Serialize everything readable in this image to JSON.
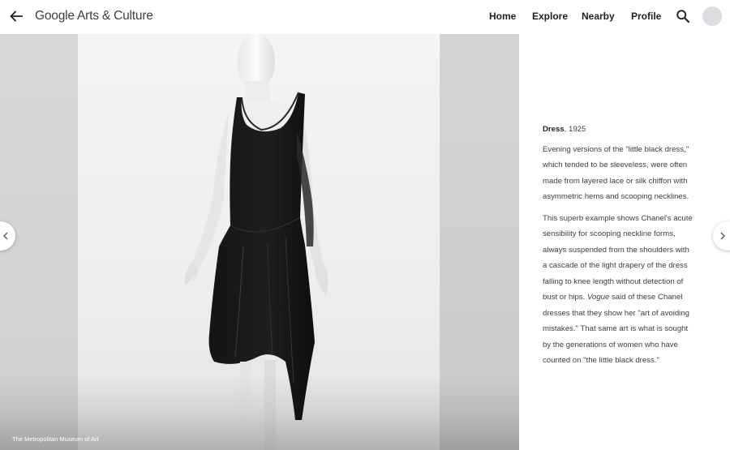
{
  "header": {
    "logo_text": "Google Arts & Culture",
    "nav": {
      "home": "Home",
      "explore": "Explore",
      "nearby": "Nearby",
      "profile": "Profile"
    },
    "icons": {
      "back": "arrow-back-icon",
      "search": "search-icon"
    }
  },
  "viewer": {
    "credit": "The Metropolitan Museum of Art",
    "prev_icon": "chevron-left-icon",
    "next_icon": "chevron-right-icon"
  },
  "artwork": {
    "title": "Dress",
    "date": ", 1925",
    "paragraph1": [
      "Evening versions of the \"little black dress,\"",
      "which tended to be sleeveless, were often",
      "made from layered lace or silk chiffon with",
      "asymmetric hems and scooping necklines."
    ],
    "paragraph2": [
      "This superb example shows Chanel's acute",
      "sensibility for scooping neckline forms,",
      "always suspended from the shoulders with",
      "a cascade of the light drapery of the dress",
      "falling to knee length without detection of"
    ],
    "p2_line6_before": "bust or hips. ",
    "p2_line6_italic": "Vogue",
    "p2_line6_after": " said of these Chanel",
    "paragraph2_end": [
      "dresses that they show her \"art of avoiding",
      "mistakes.\" That same art is what is sought",
      "by the generations of women who have",
      "counted on \"the little black dress.\""
    ]
  }
}
